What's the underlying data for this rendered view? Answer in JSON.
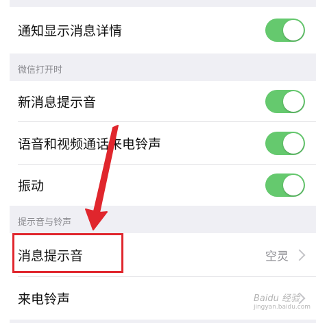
{
  "settings": {
    "row_notify_detail": {
      "label": "通知显示消息详情",
      "toggle_on": true
    },
    "section_wechat_open": {
      "label": "微信打开时"
    },
    "row_new_message_sound": {
      "label": "新消息提示音",
      "toggle_on": true
    },
    "row_voice_video_ringtone": {
      "label": "语音和视频通话来电铃声",
      "toggle_on": true
    },
    "row_vibrate": {
      "label": "振动",
      "toggle_on": true
    },
    "section_sounds": {
      "label": "提示音与铃声"
    },
    "row_message_tone": {
      "label": "消息提示音",
      "value": "空灵"
    },
    "row_ringtone": {
      "label": "来电铃声"
    }
  },
  "watermark": {
    "brand": "Baidu 经验",
    "url": "jingyan.baidu.com"
  },
  "colors": {
    "toggle_on": "#65c96e",
    "highlight": "#e0262d",
    "background": "#efeff4"
  }
}
